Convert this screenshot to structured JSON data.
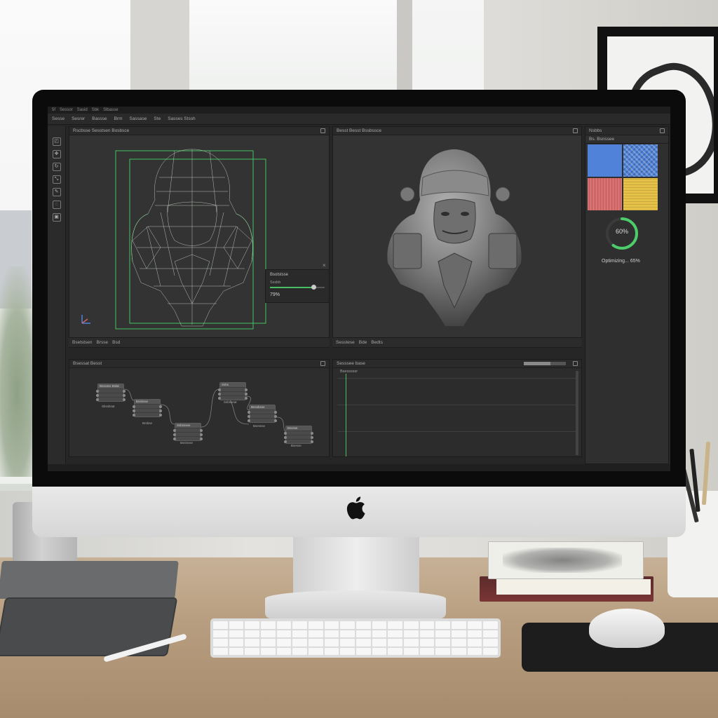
{
  "app": {
    "title_items": [
      "5f",
      "Sessor",
      "Sasid",
      "Sbk",
      "Slbasse"
    ],
    "menu_items": [
      "Sesse",
      "Sesrer",
      "Bassse",
      "Brm",
      "Sassase",
      "Ste",
      "Sasses Stssh"
    ],
    "left_panel_title": "Rscbsse Sesstsen Bosbsce",
    "right_panel_title": "Besst Besst Bssbssce",
    "slider_card": {
      "title": "Bsotstsse",
      "label": "Sssbb",
      "value_text": "79%",
      "value": 0.79
    },
    "left_mini_bar": [
      "Bsetstsen",
      "Brsse",
      "Bsd"
    ],
    "right_mini_bar": [
      "Sesstese",
      "Bde",
      "Bedts"
    ],
    "node_panel": {
      "title": "Bsessat Besst",
      "nodes": [
        {
          "title": "Bssssss Bslat",
          "label": "Sbssbsat"
        },
        {
          "title": "Bssbsse",
          "label": "Brsbse"
        },
        {
          "title": "Ssbsssee",
          "label": "Bsstssse"
        },
        {
          "title": "Ssbs",
          "label": "Ssbsseat"
        },
        {
          "title": "Bessbsse",
          "label": "Bsessse"
        },
        {
          "title": "Bsssse",
          "label": "Bsesse"
        }
      ]
    },
    "timeline_panel": {
      "title": "Sesssee base",
      "track_label": "Bsesssssr"
    },
    "tools_panel": {
      "title": "Nsbbs",
      "tab_label": "Bs. Bsnssee",
      "swatch_colors": [
        "#4f82d8",
        "#4f82d8",
        "#d06566",
        "#e5c148"
      ],
      "progress": {
        "value": 0.6,
        "text": "60%"
      },
      "status_text": "Optimizing... 65%",
      "ring_color": "#4ccc6a"
    },
    "tools": [
      "cursor-icon",
      "move-icon",
      "rotate-icon",
      "scale-icon",
      "brush-icon",
      "smooth-icon",
      "mask-icon"
    ],
    "tool_glyphs": [
      "◰",
      "✥",
      "↻",
      "⤡",
      "✎",
      "◌",
      "▣"
    ],
    "accent_green": "#45c163",
    "brand_logo": ""
  }
}
